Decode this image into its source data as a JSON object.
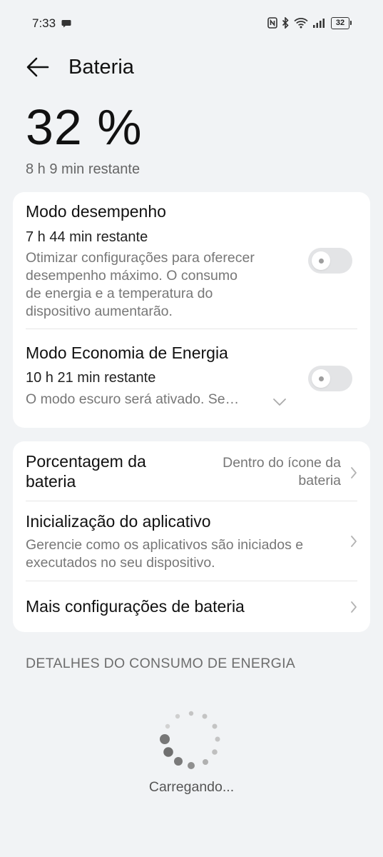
{
  "status_bar": {
    "time": "7:33",
    "battery_level": "32",
    "icons": [
      "message-icon",
      "nfc-icon",
      "bluetooth-icon",
      "wifi-icon",
      "signal-icon",
      "battery-icon"
    ]
  },
  "header": {
    "title": "Bateria",
    "back_icon": "back-arrow-icon"
  },
  "summary": {
    "percentage": "32 %",
    "remaining": "8 h 9 min restante"
  },
  "modes": {
    "performance": {
      "title": "Modo desempenho",
      "remaining": "7 h 44 min restante",
      "description_lines": [
        "Otimizar configurações para oferecer",
        "desempenho máximo. O consumo",
        "de energia e a temperatura do",
        "dispositivo aumentarão."
      ],
      "enabled": false
    },
    "power_saving": {
      "title": "Modo Economia de Energia",
      "remaining": "10 h 21 min restante",
      "description": "O modo escuro será ativado. Se…",
      "enabled": false
    }
  },
  "settings": {
    "battery_percentage": {
      "label_lines": [
        "Porcentagem da",
        "bateria"
      ],
      "value_lines": [
        "Dentro do ícone da",
        "bateria"
      ]
    },
    "app_launch": {
      "title": "Inicialização do aplicativo",
      "description_lines": [
        "Gerencie como os aplicativos são iniciados e",
        "executados no seu dispositivo."
      ]
    },
    "more": {
      "label": "Mais configurações de bateria"
    }
  },
  "section": {
    "title": "DETALHES DO CONSUMO DE ENERGIA"
  },
  "loading": {
    "text": "Carregando..."
  },
  "colors": {
    "background": "#f1f3f5",
    "card": "#ffffff",
    "toggle_off": "#e3e4e6",
    "secondary_text": "#777777"
  }
}
